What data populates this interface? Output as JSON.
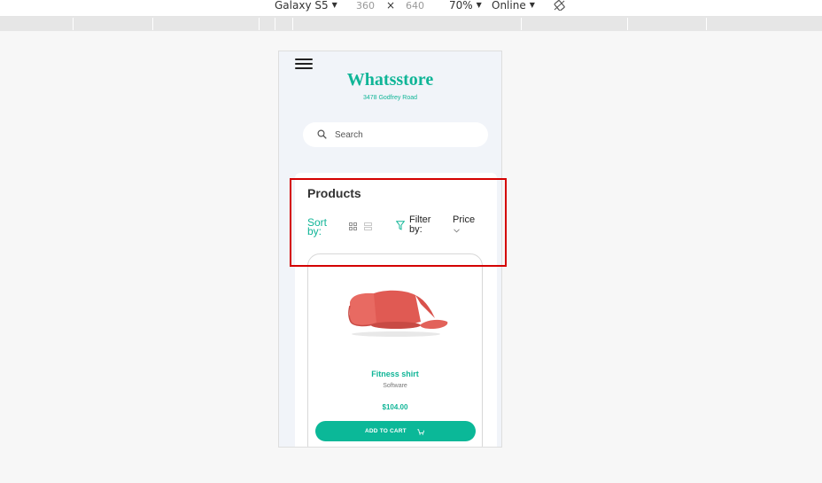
{
  "devtools": {
    "device": "Galaxy S5",
    "width": "360",
    "times": "×",
    "height": "640",
    "zoom": "70%",
    "network": "Online"
  },
  "store": {
    "name": "Whatsstore",
    "address": "3478 Godfrey Road"
  },
  "search": {
    "placeholder": "Search"
  },
  "products_section": {
    "title": "Products",
    "sort_by": "Sort by:",
    "filter_by": "Filter by:",
    "filter_selected": "Price"
  },
  "product": {
    "name": "Fitness shirt",
    "category": "Software",
    "price": "$104.00",
    "cta": "ADD TO CART"
  },
  "colors": {
    "accent": "#10b597",
    "highlight": "#d40000"
  }
}
